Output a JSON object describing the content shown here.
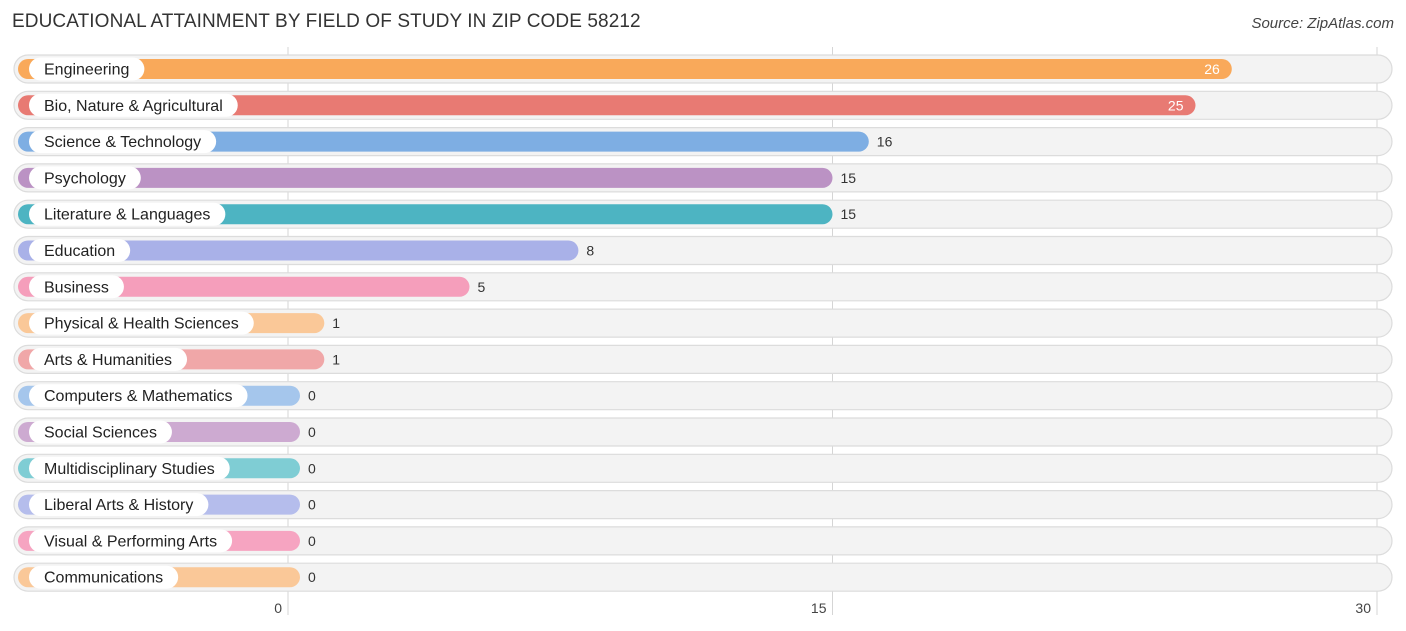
{
  "chart_data": {
    "type": "bar",
    "orientation": "horizontal",
    "title": "EDUCATIONAL ATTAINMENT BY FIELD OF STUDY IN ZIP CODE 58212",
    "source": "Source: ZipAtlas.com",
    "xlabel": "",
    "ylabel": "",
    "xlim": [
      0,
      30
    ],
    "ticks": [
      0,
      15,
      30
    ],
    "tick_labels": [
      "0",
      "15",
      "30"
    ],
    "grid": true,
    "categories": [
      "Engineering",
      "Bio, Nature & Agricultural",
      "Science & Technology",
      "Psychology",
      "Literature & Languages",
      "Education",
      "Business",
      "Physical & Health Sciences",
      "Arts & Humanities",
      "Computers & Mathematics",
      "Social Sciences",
      "Multidisciplinary Studies",
      "Liberal Arts & History",
      "Visual & Performing Arts",
      "Communications"
    ],
    "values": [
      26,
      25,
      16,
      15,
      15,
      8,
      5,
      1,
      1,
      0,
      0,
      0,
      0,
      0,
      0
    ],
    "colors": [
      "#f9a95a",
      "#e87a73",
      "#7eaee3",
      "#bb92c4",
      "#4db4c2",
      "#a9b1e8",
      "#f59ebb",
      "#fac898",
      "#f0a7a8",
      "#a5c6ec",
      "#cdaad1",
      "#7fcdd4",
      "#b5bdec",
      "#f6a4c1",
      "#fac898"
    ],
    "value_label_inside_bar": [
      true,
      true,
      false,
      false,
      false,
      false,
      false,
      false,
      false,
      false,
      false,
      false,
      false,
      false,
      false
    ]
  }
}
